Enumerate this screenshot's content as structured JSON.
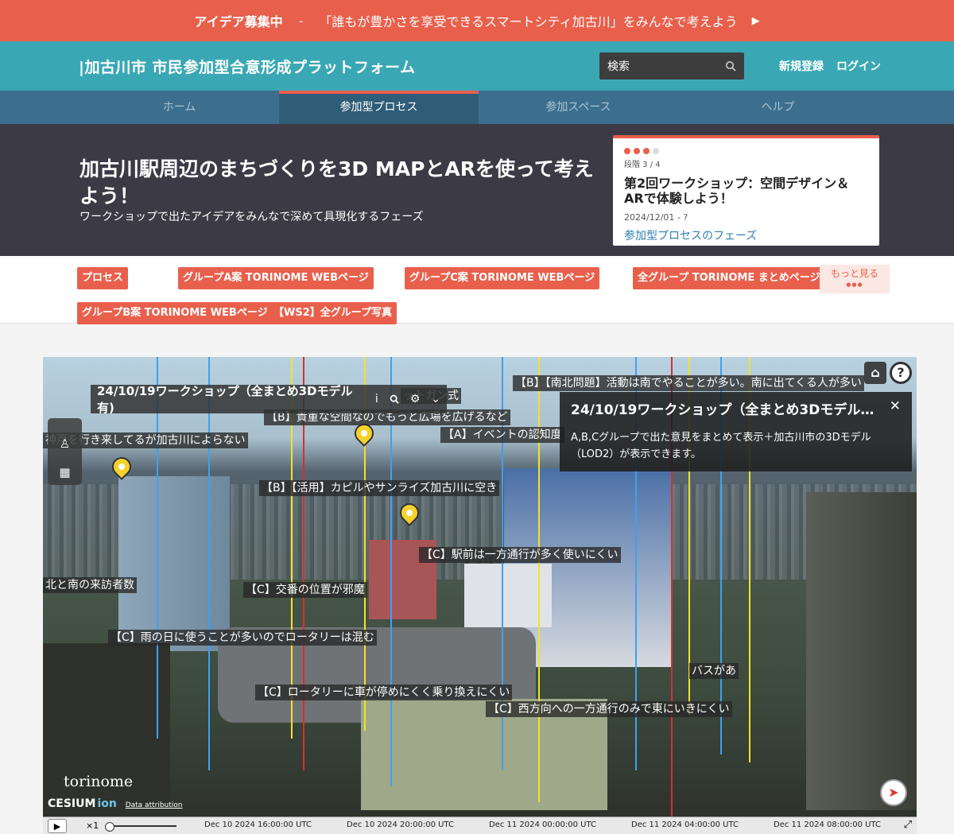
{
  "announce": {
    "label": "アイデア募集中",
    "sep": "-",
    "text": "「誰もが豊かさを享受できるスマートシティ加古川」をみんなで考えよう",
    "arrow": "▶"
  },
  "header": {
    "brand": "|加古川市 市民参加型合意形成プラットフォーム",
    "search_placeholder": "検索",
    "register": "新規登録",
    "login": "ログイン"
  },
  "nav": {
    "items": [
      {
        "label": "ホーム",
        "active": false
      },
      {
        "label": "参加型プロセス",
        "active": true
      },
      {
        "label": "参加スペース",
        "active": false
      },
      {
        "label": "ヘルプ",
        "active": false
      }
    ]
  },
  "hero": {
    "title": "加古川駅周辺のまちづくりを3D MAPとARを使って考えよう！",
    "subtitle": "ワークショップで出たアイデアをみんなで深めて具現化するフェーズ",
    "phase": {
      "stage": "段階 3 / 4",
      "title": "第2回ワークショップ：空間デザイン＆ARで体験しよう！",
      "date": "2024/12/01 - ?",
      "link": "参加型プロセスのフェーズ",
      "progress": 0.75
    }
  },
  "tags": {
    "items": [
      "プロセス",
      "グループA案 TORINOME WEBページ",
      "グループC案 TORINOME WEBページ",
      "全グループ TORINOME まとめページ",
      "グループB案 TORINOME WEBページ",
      "【WS2】全グループ写真"
    ],
    "more": "もっと見る",
    "more_dots": "●●●"
  },
  "map": {
    "layer_title": "24/10/19ワークショップ（全まとめ3Dモデル有)",
    "popup": {
      "title": "24/10/19ワークショップ（全まとめ3Dモデル…",
      "close": "✕",
      "body": "A,B,Cグループで出た意見をまとめて表示＋加古川市の3Dモデル（LOD2）が表示できます。"
    },
    "labels": [
      "【B】【南北問題】活動は南でやることが多い。南に出てくる人が多い",
      "ットガン式",
      "【B】貴重な空間なのでもっと広場を広げるなど",
      "【A】イベントの認知度",
      "神戸を行き来してるが加古川によらない",
      "【B】【活用】カピルやサンライズ加古川に空き",
      "【C】駅前は一方通行が多く使いにくい",
      "北と南の来訪者数",
      "【C】交番の位置が邪魔",
      "【C】雨の日に使うことが多いのでロータリーは混む",
      "【C】ロータリーに車が停めにくく乗り換えにくい",
      "【C】西方向への一方通行のみで東にいきにくい",
      "バスがあ"
    ],
    "logo_torinome": "torinome",
    "logo_cesium": "CESIUM",
    "logo_ion": "ion",
    "attribution": "Data attribution",
    "speed": "×1",
    "timeline": [
      "Dec 10 2024 16:00:00 UTC",
      "Dec 10 2024 20:00:00 UTC",
      "Dec 11 2024 00:00:00 UTC",
      "Dec 11 2024 04:00:00 UTC",
      "Dec 11 2024 08:00:00 UTC"
    ]
  }
}
